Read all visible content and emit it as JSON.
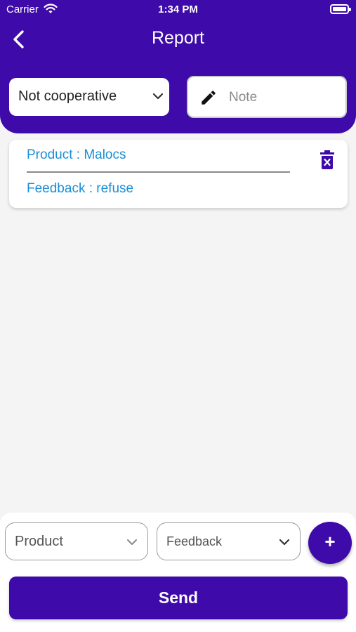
{
  "status_bar": {
    "carrier": "Carrier",
    "time": "1:34 PM"
  },
  "header": {
    "title": "Report",
    "back_icon": "chevron-left-icon",
    "background_color": "#3e0aa9"
  },
  "filters": {
    "status_value": "Not cooperative",
    "note_placeholder": "Note",
    "note_value": ""
  },
  "report_items": [
    {
      "product": "Product : Malocs",
      "feedback": "Feedback : refuse",
      "delete_icon": "trash-icon"
    }
  ],
  "bottom": {
    "product_placeholder": "Product",
    "feedback_placeholder": "Feedback",
    "add_label": "+",
    "send_label": "Send"
  },
  "colors": {
    "accent": "#3e0aa9",
    "link_text": "#1a8fd6"
  }
}
